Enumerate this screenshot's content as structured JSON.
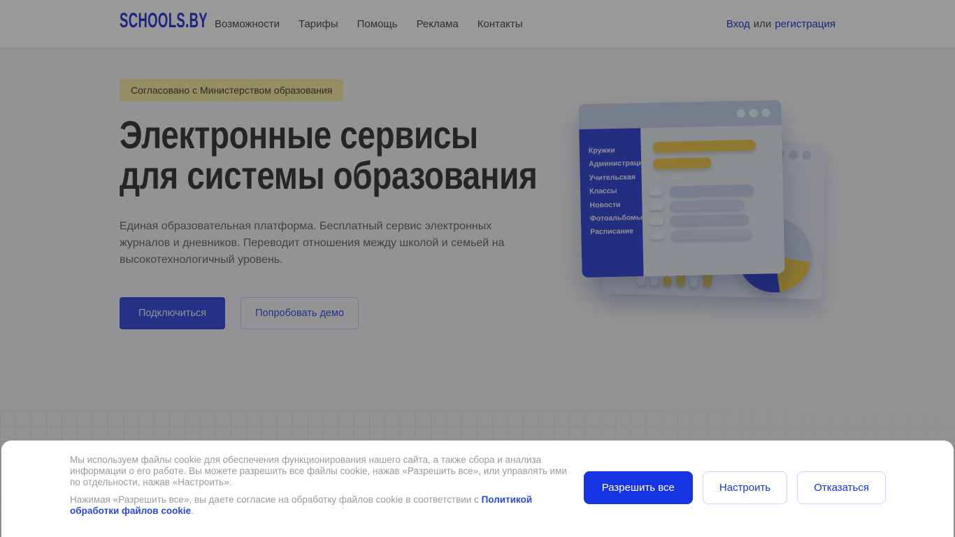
{
  "header": {
    "logo": "SCHOOLS.BY",
    "nav": [
      "Возможности",
      "Тарифы",
      "Помощь",
      "Реклама",
      "Контакты"
    ],
    "auth": {
      "login": "Вход",
      "separator": "или",
      "register": "регистрация"
    }
  },
  "hero": {
    "badge": "Согласовано с Министерством образования",
    "title_line1": "Электронные сервисы",
    "title_line2": "для системы образования",
    "description": "Единая образовательная платформа. Бесплатный сервис электронных журналов и дневников. Переводит отношения между школой и семьей на высокотехнологичный уровень.",
    "primary_button": "Подключиться",
    "secondary_button": "Попробовать демо"
  },
  "illustration": {
    "sidebar_items": [
      "Кружки",
      "Администрация",
      "Учительская",
      "Классы",
      "Новости",
      "Фотоальбомы",
      "Расписание"
    ],
    "colors": {
      "blue": "#3C4ED8",
      "yellow": "#EFC94F",
      "panel": "#E9EDF6",
      "titlebar": "#C7D2E8",
      "row_light": "#C9D4EA"
    }
  },
  "colors": {
    "brand_blue": "#2B3FD6",
    "primary_button_blue": "#3D52E0",
    "cookie_button_blue": "#1634E4",
    "badge_yellow": "#F7EDA4",
    "overlay": "rgba(0,0,0,0.40)"
  },
  "cookie_banner": {
    "paragraph1": "Мы используем файлы cookie для обеспечения функционирования нашего сайта, а также сбора и анализа информации о его работе. Вы можете разрешить все файлы cookie, нажав «Разрешить все», или управлять ими по отдельности, нажав «Настроить».",
    "paragraph2_prefix": "Нажимая «Разрешить все», вы даете согласие на обработку файлов cookie в соответствии с ",
    "paragraph2_link": "Политикой обработки файлов cookie",
    "paragraph2_suffix": ".",
    "buttons": {
      "allow": "Разрешить все",
      "configure": "Настроить",
      "decline": "Отказаться"
    }
  }
}
